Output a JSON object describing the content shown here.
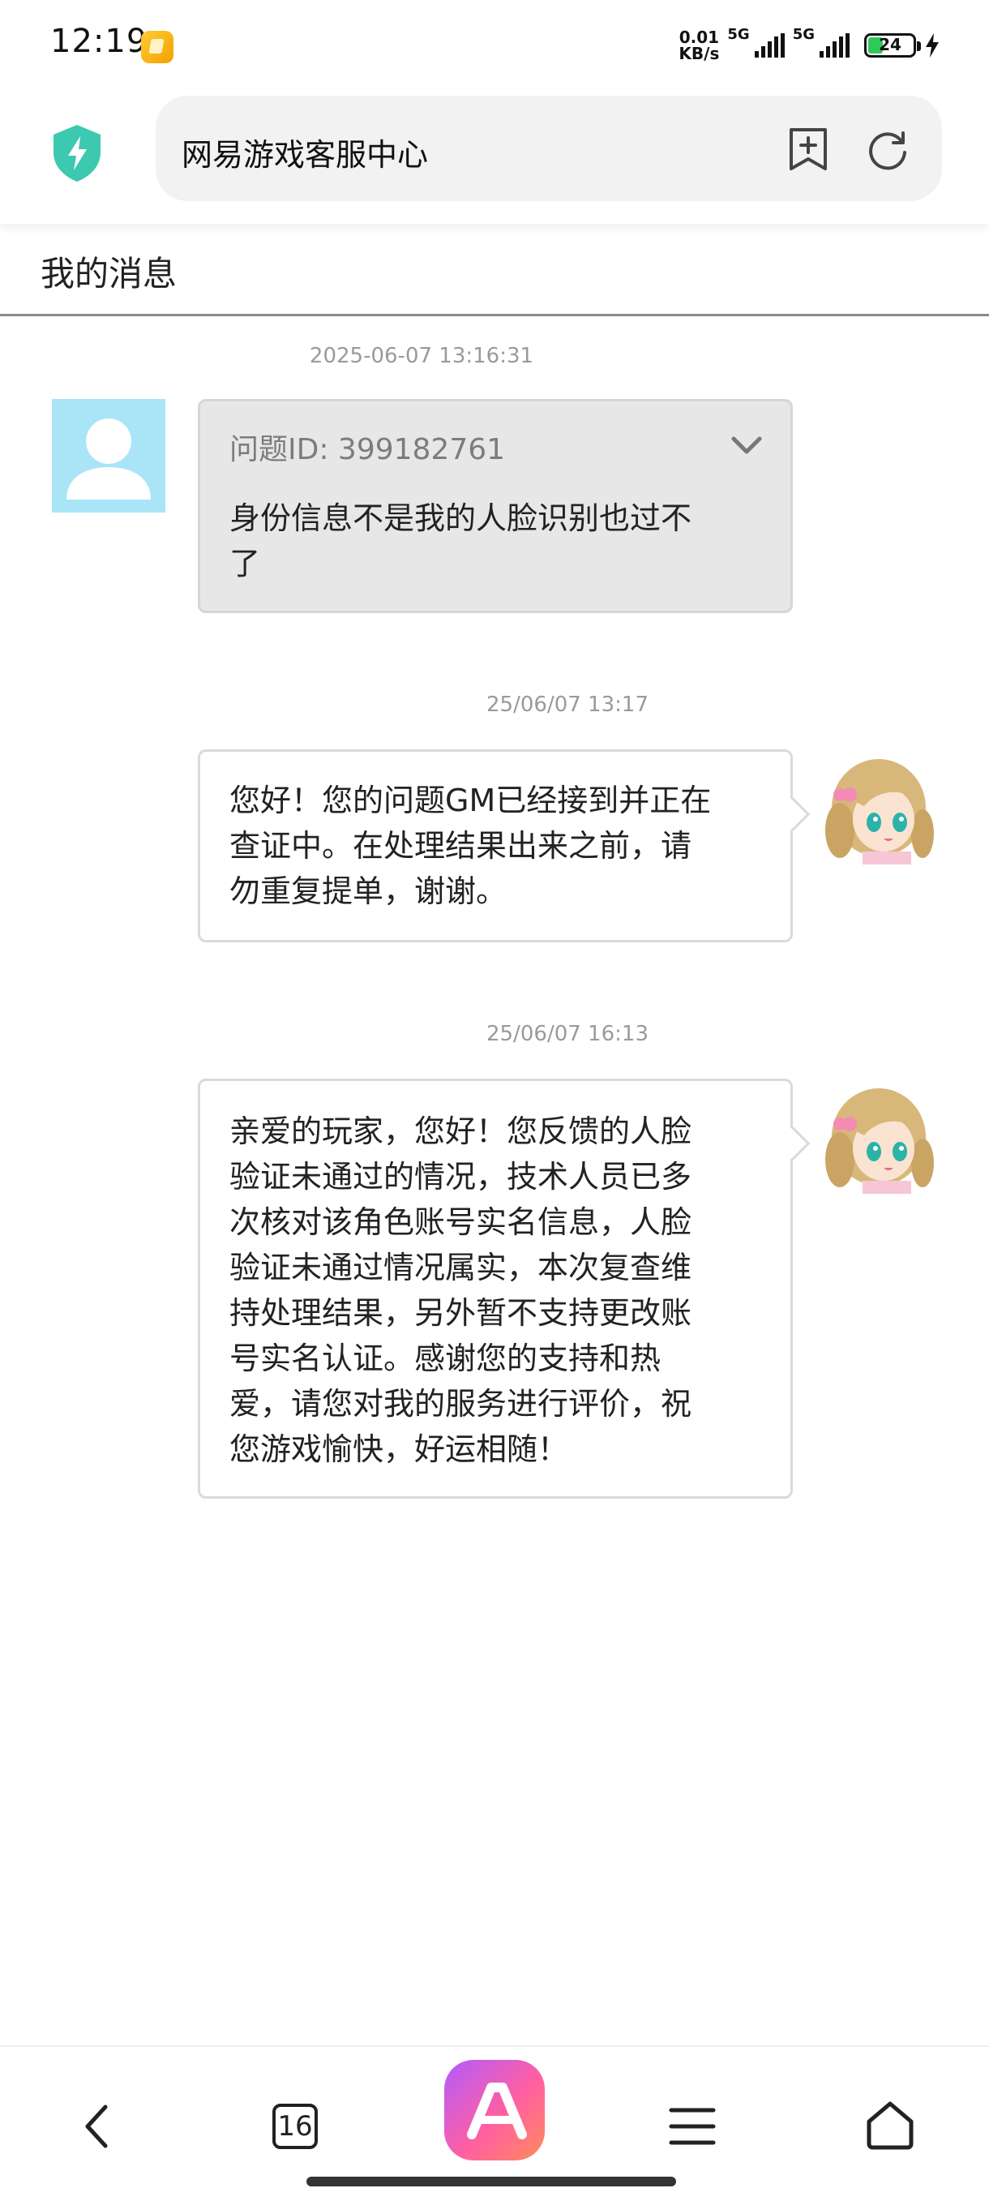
{
  "status_bar": {
    "time": "12:19",
    "net_speed_value": "0.01",
    "net_speed_unit": "KB/s",
    "network_1": "5G",
    "network_2": "5G",
    "battery": "24"
  },
  "browser": {
    "url_title": "网易游戏客服中心"
  },
  "page": {
    "title": "我的消息"
  },
  "messages": [
    {
      "sender": "user",
      "timestamp": "2025-06-07 13:16:31",
      "question_id": "问题ID: 399182761",
      "text": "身份信息不是我的人脸识别也过不\n了"
    },
    {
      "sender": "gm",
      "timestamp": "25/06/07 13:17",
      "text": "您好！您的问题GM已经接到并正在\n查证中。在处理结果出来之前，请\n勿重复提单，谢谢。"
    },
    {
      "sender": "gm",
      "timestamp": "25/06/07 16:13",
      "text": "亲爱的玩家，您好！您反馈的人脸\n验证未通过的情况，技术人员已多\n次核对该角色账号实名信息，人脸\n验证未通过情况属实，本次复查维\n持处理结果，另外暂不支持更改账\n号实名认证。感谢您的支持和热\n爱，请您对我的服务进行评价，祝\n您游戏愉快，好运相随！"
    }
  ],
  "bottom_nav": {
    "tab_count": "16"
  },
  "colors": {
    "accent_shield": "#3cc9b0",
    "user_bubble": "#e7e7e7",
    "avatar_bg": "#a9e4f7"
  },
  "icons": [
    "shield-icon",
    "bookmark-add-icon",
    "refresh-icon",
    "chevron-down-icon",
    "back-icon",
    "tabs-icon",
    "ai-assistant-icon",
    "menu-icon",
    "home-icon"
  ]
}
